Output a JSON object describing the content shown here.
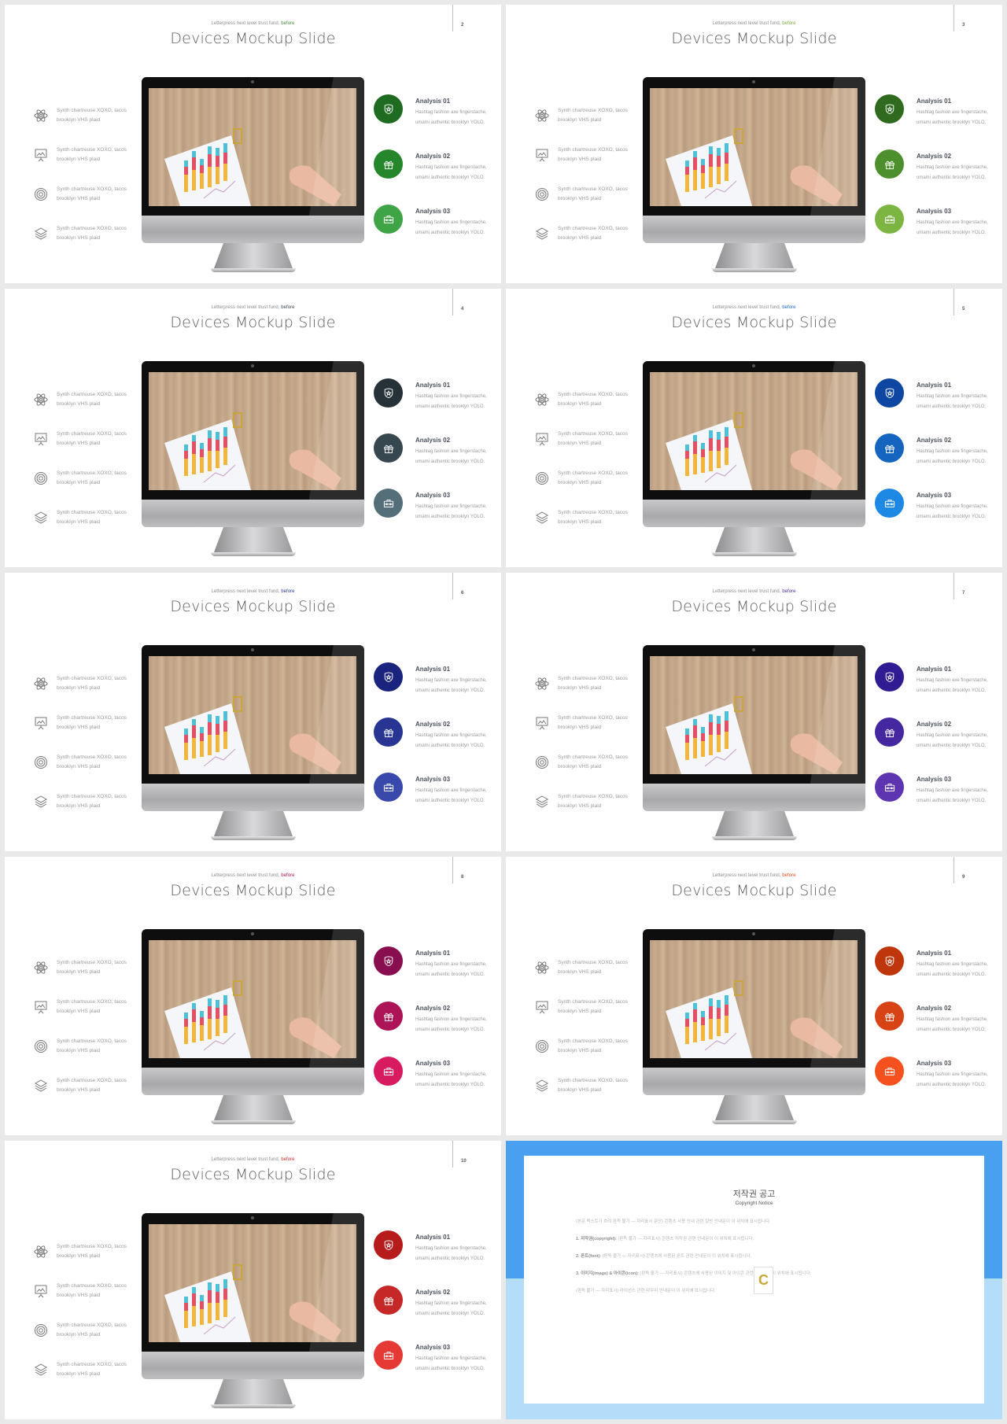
{
  "slide_template": {
    "subtitle_prefix": "Letterpress next level trust fund, ",
    "subtitle_highlight": "before",
    "title": "Devices Mockup Slide",
    "features": [
      {
        "icon": "atom-icon",
        "text": "Synth chartreuse XOXO, tacos brooklyn VHS plaid"
      },
      {
        "icon": "presentation-board-icon",
        "text": "Synth chartreuse XOXO, tacos brooklyn VHS plaid"
      },
      {
        "icon": "target-icon",
        "text": "Synth chartreuse XOXO, tacos brooklyn VHS plaid"
      },
      {
        "icon": "layers-icon",
        "text": "Synth chartreuse XOXO, tacos brooklyn VHS plaid"
      }
    ],
    "analyses": [
      {
        "title": "Analysis 01",
        "icon": "shield-star-icon",
        "desc": "Hashtag fashion axe fingerstache, umami authentic brooklyn YOLO."
      },
      {
        "title": "Analysis 02",
        "icon": "gift-icon",
        "desc": "Hashtag fashion axe fingerstache, umami authentic brooklyn YOLO."
      },
      {
        "title": "Analysis 03",
        "icon": "toolbox-icon",
        "desc": "Hashtag fashion axe fingerstache, umami authentic brooklyn YOLO."
      }
    ],
    "monitor_image": "desk-chart-fist-photo"
  },
  "slides": [
    {
      "page": "2",
      "highlight_color": "#4c8a3a",
      "colors": [
        "#1f6b22",
        "#26862b",
        "#3fa446"
      ]
    },
    {
      "page": "3",
      "highlight_color": "#7aa83c",
      "colors": [
        "#2f6a1f",
        "#4d8f2c",
        "#7db542"
      ]
    },
    {
      "page": "4",
      "highlight_color": "#37474f",
      "colors": [
        "#263238",
        "#37474f",
        "#546e7a"
      ]
    },
    {
      "page": "5",
      "highlight_color": "#1565c0",
      "colors": [
        "#0d47a1",
        "#1565c0",
        "#1e88e5"
      ]
    },
    {
      "page": "6",
      "highlight_color": "#283593",
      "colors": [
        "#1a237e",
        "#283593",
        "#3949ab"
      ]
    },
    {
      "page": "7",
      "highlight_color": "#4527a0",
      "colors": [
        "#311b92",
        "#4527a0",
        "#5e35b1"
      ]
    },
    {
      "page": "8",
      "highlight_color": "#ad1457",
      "colors": [
        "#880e4f",
        "#ad1457",
        "#d81b60"
      ]
    },
    {
      "page": "9",
      "highlight_color": "#e64a19",
      "colors": [
        "#bf360c",
        "#d84315",
        "#f4511e"
      ]
    },
    {
      "page": "10",
      "highlight_color": "#c62828",
      "colors": [
        "#b71c1c",
        "#c62828",
        "#e53935"
      ]
    }
  ],
  "copyright": {
    "title": "저작권 공고",
    "subtitle": "Copyright Notice",
    "paragraphs": [
      {
        "lead": "",
        "text": "(본문 텍스트가 흐려 판독 불가 — 자리표시 문단) 콘텐츠 사용 안내 관련 일반 안내문이 이 위치에 표시됩니다."
      },
      {
        "lead": "1. 저작권(copyright): ",
        "text": "(판독 불가 — 자리표시) 콘텐츠 저작권 관련 안내문이 이 위치에 표시됩니다."
      },
      {
        "lead": "2. 폰트(font): ",
        "text": "(판독 불가 — 자리표시) 콘텐츠에 사용된 폰트 관련 안내문이 이 위치에 표시됩니다."
      },
      {
        "lead": "3. 이미지(image) & 아이콘(icon): ",
        "text": "(판독 불가 — 자리표시) 콘텐츠에 사용된 이미지 및 아이콘 관련 안내문이 이 위치에 표시됩니다."
      },
      {
        "lead": "",
        "text": "(판독 불가 — 자리표시) 라이선스 관련 마무리 안내문이 이 위치에 표시됩니다."
      }
    ],
    "logo_letter": "C"
  }
}
